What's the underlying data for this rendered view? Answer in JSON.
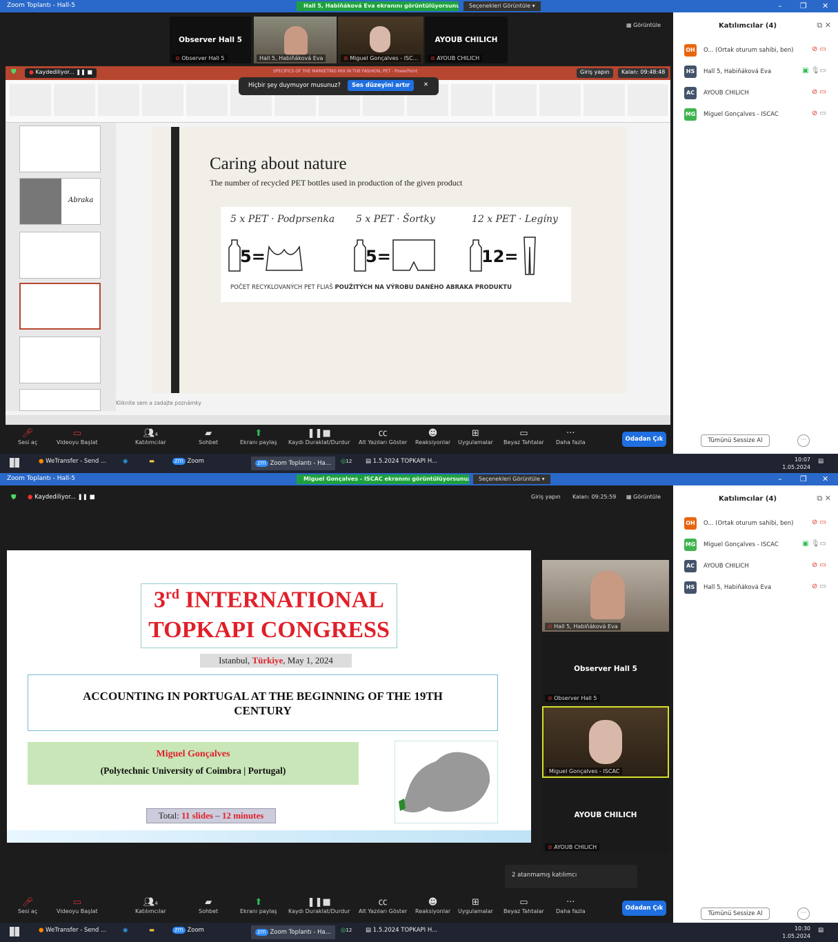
{
  "shot1": {
    "window_title": "Zoom Toplantı - Hall-5",
    "share_banner": "Hall 5, Habiňáková Eva ekranını görüntülüyorsunuz",
    "view_options": "Seçenekleri Görüntüle",
    "view_btn": "Görüntüle",
    "tiles": [
      {
        "big": "Observer Hall 5",
        "tag": "Observer Hall 5"
      },
      {
        "tag": "Hall 5, Habiňáková Eva"
      },
      {
        "tag": "Miguel Gonçalves - ISC..."
      },
      {
        "big": "AYOUB CHILICH",
        "tag": "AYOUB CHILICH"
      }
    ],
    "recording": "Kaydediliyor...",
    "ppt_file": "SPECIFICS OF THE MARKETING MIX IN THE FASHION, PET - PowerPoint",
    "signin": "Giriş yapın",
    "remaining": "Kalan: 09:48:48",
    "audio_tip": "Hiçbir şey duymuyor musunuz?",
    "audio_btn": "Ses düzeyini artır",
    "slide": {
      "title": "Caring about nature",
      "subtitle": "The number of recycled PET bottles used in production of the given product",
      "items": [
        {
          "hand": "5 x PET · Podprsenka",
          "num": "5="
        },
        {
          "hand": "5 x PET · Šortky",
          "num": "5="
        },
        {
          "hand": "12 x PET · Legíny",
          "num": "12="
        }
      ],
      "caption_a": "POČET RECYKLOVANÝCH PET FLIAŠ ",
      "caption_b": "POUŽITÝCH NA VÝROBU DANÉHO ABRAKA PRODUKTU"
    },
    "thumb_logo": "Abraka",
    "notes": "Kliknite sem a zadajte poznámky",
    "participants": {
      "header": "Katılımcılar (4)",
      "items": [
        {
          "initials": "OH",
          "color": "#e8650f",
          "name": "O... (Ortak oturum sahibi, ben)"
        },
        {
          "initials": "HS",
          "color": "#43536b",
          "name": "Hall 5, Habiňáková Eva"
        },
        {
          "initials": "AC",
          "color": "#43536b",
          "name": "AYOUB CHILICH"
        },
        {
          "initials": "MG",
          "color": "#3fb34f",
          "name": "Miguel Gonçalves - ISCAC"
        }
      ],
      "mute_all": "Tümünü Sessize Al"
    },
    "clock": {
      "time": "10:07",
      "date": "1.05.2024"
    }
  },
  "shot2": {
    "window_title": "Zoom Toplantı - Hall-5",
    "share_banner": "Miguel Gonçalves - ISCAC ekranını görüntülüyorsunuz",
    "view_options": "Seçenekleri Görüntüle",
    "recording": "Kaydediliyor...",
    "signin": "Giriş yapın",
    "remaining": "Kalan: 09:25:59",
    "view_btn": "Görüntüle",
    "slide": {
      "title1a": "3",
      "title1sup": "rd",
      "title1b": " INTERNATIONAL",
      "title2": "TOPKAPI CONGRESS",
      "loc_a": "Istanbul, ",
      "loc_b": "Türkiye",
      "loc_c": ", May 1, 2024",
      "paper": "ACCOUNTING IN PORTUGAL AT THE BEGINNING OF THE 19TH CENTURY",
      "author": "Miguel Gonçalves",
      "affil": "(Polytechnic University of Coimbra | Portugal)",
      "total_a": "Total: ",
      "total_b": "11 slides",
      "total_c": " – ",
      "total_d": "12 minutes"
    },
    "tiles": [
      {
        "tag": "Hall 5, Habiňáková Eva"
      },
      {
        "big": "Observer Hall 5",
        "tag": "Observer Hall 5"
      },
      {
        "tag": "Miguel Gonçalves - ISCAC"
      },
      {
        "big": "AYOUB CHILICH",
        "tag": "AYOUB CHILICH"
      }
    ],
    "unassigned": "2 atanmamış katılımcı",
    "participants": {
      "header": "Katılımcılar (4)",
      "items": [
        {
          "initials": "OH",
          "color": "#e8650f",
          "name": "O... (Ortak oturum sahibi, ben)"
        },
        {
          "initials": "MG",
          "color": "#3fb34f",
          "name": "Miguel Gonçalves - ISCAC"
        },
        {
          "initials": "AC",
          "color": "#43536b",
          "name": "AYOUB CHILICH"
        },
        {
          "initials": "HS",
          "color": "#43536b",
          "name": "Hall 5, Habiňáková Eva"
        }
      ],
      "mute_all": "Tümünü Sessize Al"
    },
    "clock": {
      "time": "10:30",
      "date": "1.05.2024"
    }
  },
  "toolbar": {
    "audio": "Sesi aç",
    "video": "Videoyu Başlat",
    "participants": "Katılımcılar",
    "participants_count": "4",
    "chat": "Sohbet",
    "share": "Ekranı paylaş",
    "record": "Kaydı Duraklat/Durdur",
    "cc": "Alt Yazıları Göster",
    "reactions": "Reaksiyonlar",
    "apps": "Uygulamalar",
    "whiteboard": "Beyaz Tahtalar",
    "more": "Daha fazla",
    "leave": "Odadan Çık"
  },
  "taskbar": {
    "wetransfer": "WeTransfer - Send ...",
    "zoom": "Zoom",
    "zoom_meeting": "Zoom Toplantı - Ha...",
    "whatsapp_count": "12",
    "file": "1.5.2024 TOPKAPI H..."
  }
}
